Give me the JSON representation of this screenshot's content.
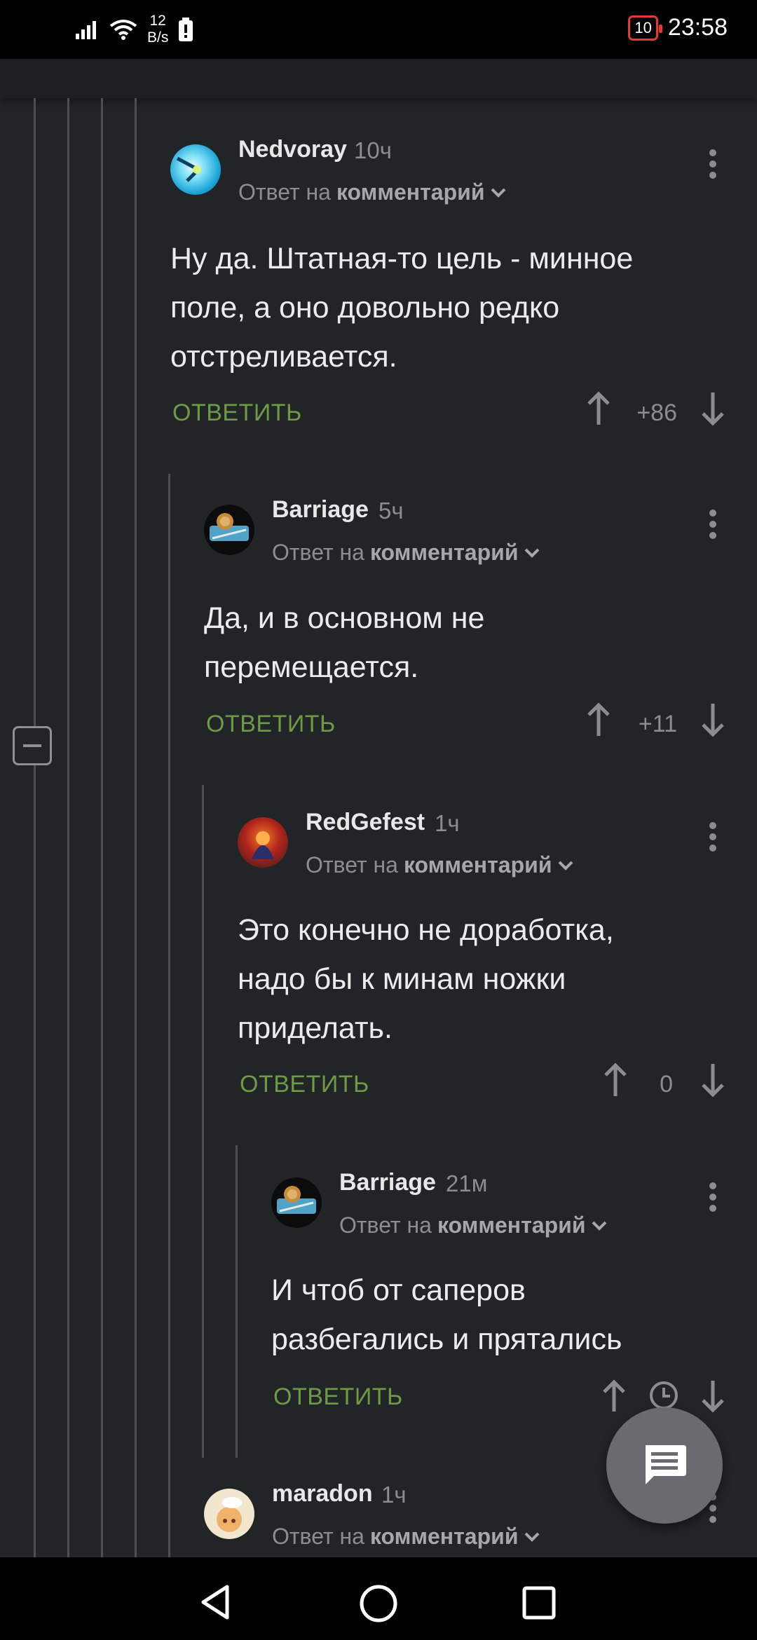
{
  "status_bar": {
    "net_speed_value": "12",
    "net_speed_unit": "B/s",
    "battery_level": "10",
    "time": "23:58"
  },
  "common": {
    "reply_to_prefix": "Ответ на",
    "reply_to_target": "комментарий",
    "reply_label": "ОТВЕТИТЬ"
  },
  "comments": [
    {
      "author": "Nedvoray",
      "time": "10ч",
      "text": "Ну да. Штатная-то цель - минное поле, а оно довольно редко отстреливается.",
      "score": "+86"
    },
    {
      "author": "Barriage",
      "time": "5ч",
      "text": "Да, и в основном не перемещается.",
      "score": "+11"
    },
    {
      "author": "RedGefest",
      "time": "1ч",
      "text": "Это конечно не доработка, надо бы к минам ножки приделать.",
      "score": "0"
    },
    {
      "author": "Barriage",
      "time": "21м",
      "text": "И чтоб от саперов разбегались и прятались",
      "score": ""
    },
    {
      "author": "maradon",
      "time": "1ч",
      "text": "",
      "score": ""
    }
  ],
  "colors": {
    "background": "#222528",
    "accent_reply": "#6f9a45",
    "muted": "#8a8e93"
  }
}
